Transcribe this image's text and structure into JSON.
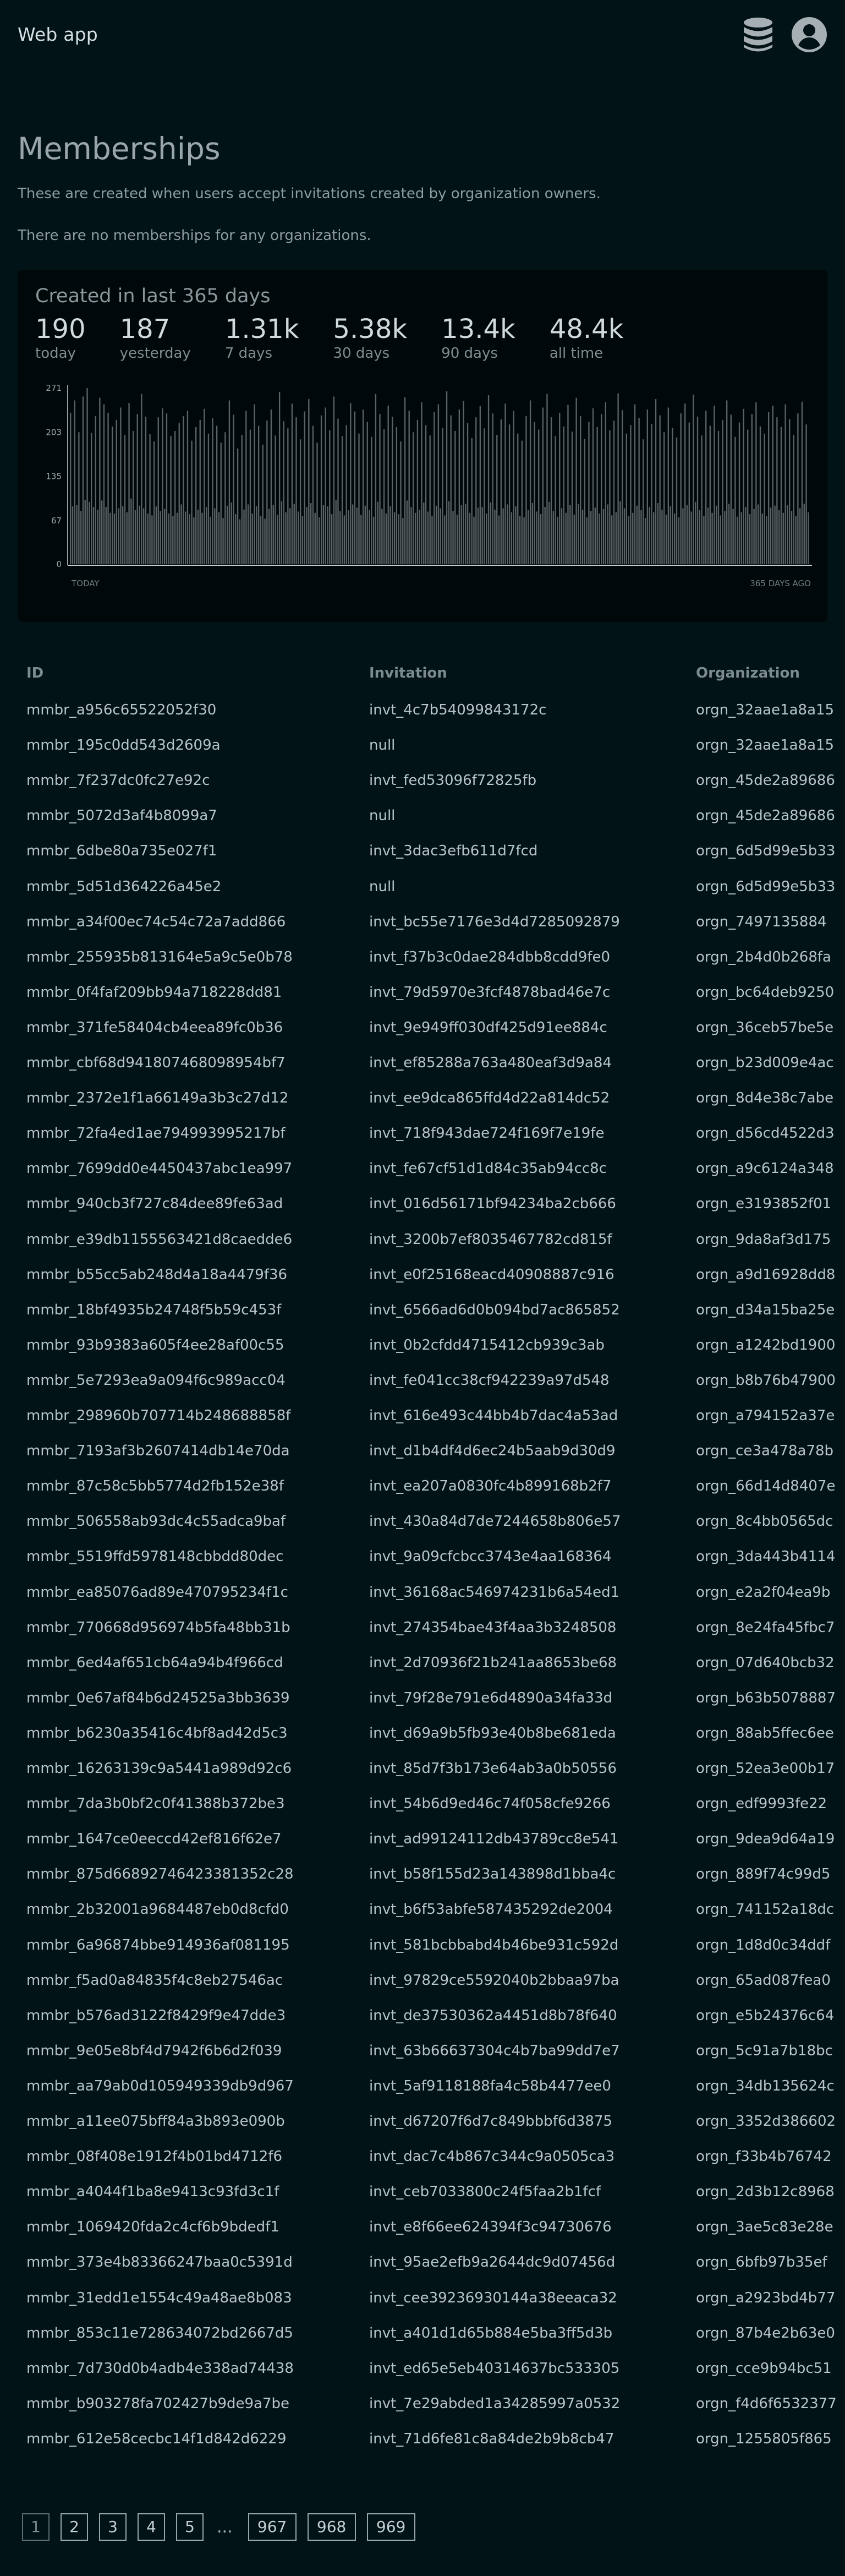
{
  "header": {
    "app_title": "Web app",
    "icons": [
      "database-icon",
      "user-account-icon"
    ]
  },
  "page": {
    "title": "Memberships",
    "description": "These are created when users accept invitations created by organization owners.",
    "empty_note": "There are no memberships for any organizations."
  },
  "stats_card": {
    "title": "Created in last 365 days",
    "stats": [
      {
        "value": "190",
        "label": "today"
      },
      {
        "value": "187",
        "label": "yesterday"
      },
      {
        "value": "1.31k",
        "label": "7 days"
      },
      {
        "value": "5.38k",
        "label": "30 days"
      },
      {
        "value": "13.4k",
        "label": "90 days"
      },
      {
        "value": "48.4k",
        "label": "all time"
      }
    ]
  },
  "chart_data": {
    "type": "bar",
    "y_ticks": [
      "271",
      "203",
      "135",
      "67",
      "0"
    ],
    "x_start_label": "TODAY",
    "x_end_label": "365 DAYS AGO",
    "ylim": [
      0,
      271
    ],
    "bar_count": 365,
    "bar_color": "#5b6265",
    "values": [
      233,
      89,
      252,
      91,
      203,
      82,
      258,
      99,
      271,
      96,
      202,
      88,
      228,
      84,
      256,
      98,
      246,
      88,
      233,
      79,
      212,
      78,
      222,
      86,
      241,
      89,
      199,
      80,
      248,
      101,
      205,
      83,
      231,
      90,
      262,
      86,
      227,
      78,
      200,
      75,
      189,
      89,
      226,
      82,
      240,
      85,
      232,
      78,
      197,
      74,
      205,
      79,
      217,
      92,
      228,
      81,
      236,
      77,
      190,
      72,
      211,
      84,
      222,
      79,
      239,
      88,
      201,
      73,
      225,
      86,
      213,
      80,
      187,
      71,
      203,
      90,
      252,
      95,
      230,
      77,
      178,
      69,
      199,
      84,
      236,
      92,
      207,
      78,
      246,
      89,
      213,
      74,
      184,
      70,
      221,
      85,
      238,
      91,
      198,
      76,
      265,
      97,
      220,
      80,
      209,
      86,
      247,
      93,
      226,
      81,
      192,
      74,
      235,
      88,
      254,
      94,
      213,
      79,
      187,
      72,
      229,
      91,
      241,
      89,
      206,
      77,
      258,
      99,
      224,
      82,
      197,
      75,
      214,
      83,
      248,
      92,
      235,
      87,
      201,
      76,
      238,
      90,
      219,
      84,
      196,
      73,
      262,
      96,
      231,
      85,
      208,
      78,
      244,
      89,
      227,
      80,
      211,
      77,
      189,
      71,
      257,
      98,
      236,
      88,
      203,
      79,
      222,
      84,
      249,
      95,
      214,
      81,
      198,
      74,
      234,
      90,
      246,
      86,
      210,
      75,
      266,
      97,
      229,
      82,
      205,
      76,
      238,
      91,
      251,
      93,
      217,
      79,
      194,
      73,
      226,
      87,
      243,
      88,
      209,
      78,
      260,
      95,
      232,
      84,
      199,
      75,
      223,
      86,
      247,
      92,
      215,
      80,
      236,
      89,
      201,
      74,
      190,
      72,
      228,
      83,
      252,
      94,
      219,
      81,
      207,
      77,
      241,
      88,
      262,
      96,
      226,
      82,
      197,
      73,
      233,
      86,
      212,
      79,
      245,
      91,
      204,
      76,
      256,
      93,
      228,
      84,
      193,
      72,
      219,
      82,
      240,
      87,
      211,
      78,
      231,
      85,
      249,
      92,
      206,
      75,
      221,
      80,
      263,
      97,
      237,
      86,
      201,
      74,
      214,
      79,
      246,
      90,
      225,
      83,
      192,
      71,
      238,
      88,
      216,
      80,
      254,
      94,
      229,
      84,
      203,
      76,
      241,
      89,
      210,
      78,
      195,
      72,
      232,
      86,
      247,
      91,
      218,
      81,
      261,
      96,
      227,
      83,
      198,
      74,
      236,
      87,
      213,
      79,
      244,
      90,
      205,
      75,
      222,
      82,
      252,
      93,
      230,
      85,
      196,
      73,
      218,
      80,
      239,
      88,
      207,
      77,
      231,
      85,
      249,
      92,
      212,
      78,
      201,
      74,
      234,
      87,
      244,
      90,
      226,
      83,
      211,
      79,
      246,
      91,
      223,
      82,
      199,
      74,
      232,
      86,
      250,
      93,
      215,
      80
    ]
  },
  "table": {
    "headers": [
      "ID",
      "Invitation",
      "Organization"
    ],
    "rows": [
      [
        "mmbr_a956c65522052f30",
        "invt_4c7b54099843172c",
        "orgn_32aae1a8a15"
      ],
      [
        "mmbr_195c0dd543d2609a",
        "null",
        "orgn_32aae1a8a15"
      ],
      [
        "mmbr_7f237dc0fc27e92c",
        "invt_fed53096f72825fb",
        "orgn_45de2a89686"
      ],
      [
        "mmbr_5072d3af4b8099a7",
        "null",
        "orgn_45de2a89686"
      ],
      [
        "mmbr_6dbe80a735e027f1",
        "invt_3dac3efb611d7fcd",
        "orgn_6d5d99e5b33"
      ],
      [
        "mmbr_5d51d364226a45e2",
        "null",
        "orgn_6d5d99e5b33"
      ],
      [
        "mmbr_a34f00ec74c54c72a7add866",
        "invt_bc55e7176e3d4d7285092879",
        "orgn_7497135884"
      ],
      [
        "mmbr_255935b813164e5a9c5e0b78",
        "invt_f37b3c0dae284dbb8cdd9fe0",
        "orgn_2b4d0b268fa"
      ],
      [
        "mmbr_0f4faf209bb94a718228dd81",
        "invt_79d5970e3fcf4878bad46e7c",
        "orgn_bc64deb9250"
      ],
      [
        "mmbr_371fe58404cb4eea89fc0b36",
        "invt_9e949ff030df425d91ee884c",
        "orgn_36ceb57be5e"
      ],
      [
        "mmbr_cbf68d941807468098954bf7",
        "invt_ef85288a763a480eaf3d9a84",
        "orgn_b23d009e4ac"
      ],
      [
        "mmbr_2372e1f1a66149a3b3c27d12",
        "invt_ee9dca865ffd4d22a814dc52",
        "orgn_8d4e38c7abe"
      ],
      [
        "mmbr_72fa4ed1ae794993995217bf",
        "invt_718f943dae724f169f7e19fe",
        "orgn_d56cd4522d3"
      ],
      [
        "mmbr_7699dd0e4450437abc1ea997",
        "invt_fe67cf51d1d84c35ab94cc8c",
        "orgn_a9c6124a348"
      ],
      [
        "mmbr_940cb3f727c84dee89fe63ad",
        "invt_016d56171bf94234ba2cb666",
        "orgn_e3193852f01"
      ],
      [
        "mmbr_e39db1155563421d8caedde6",
        "invt_3200b7ef8035467782cd815f",
        "orgn_9da8af3d175"
      ],
      [
        "mmbr_b55cc5ab248d4a18a4479f36",
        "invt_e0f25168eacd40908887c916",
        "orgn_a9d16928dd8"
      ],
      [
        "mmbr_18bf4935b24748f5b59c453f",
        "invt_6566ad6d0b094bd7ac865852",
        "orgn_d34a15ba25e"
      ],
      [
        "mmbr_93b9383a605f4ee28af00c55",
        "invt_0b2cfdd4715412cb939c3ab",
        "orgn_a1242bd1900"
      ],
      [
        "mmbr_5e7293ea9a094f6c989acc04",
        "invt_fe041cc38cf942239a97d548",
        "orgn_b8b76b47900"
      ],
      [
        "mmbr_298960b707714b248688858f",
        "invt_616e493c44bb4b7dac4a53ad",
        "orgn_a794152a37e"
      ],
      [
        "mmbr_7193af3b2607414db14e70da",
        "invt_d1b4df4d6ec24b5aab9d30d9",
        "orgn_ce3a478a78b"
      ],
      [
        "mmbr_87c58c5bb5774d2fb152e38f",
        "invt_ea207a0830fc4b899168b2f7",
        "orgn_66d14d8407e"
      ],
      [
        "mmbr_506558ab93dc4c55adca9baf",
        "invt_430a84d7de7244658b806e57",
        "orgn_8c4bb0565dc"
      ],
      [
        "mmbr_5519ffd5978148cbbdd80dec",
        "invt_9a09cfcbcc3743e4aa168364",
        "orgn_3da443b4114"
      ],
      [
        "mmbr_ea85076ad89e470795234f1c",
        "invt_36168ac546974231b6a54ed1",
        "orgn_e2a2f04ea9b"
      ],
      [
        "mmbr_770668d956974b5fa48bb31b",
        "invt_274354bae43f4aa3b3248508",
        "orgn_8e24fa45fbc7"
      ],
      [
        "mmbr_6ed4af651cb64a94b4f966cd",
        "invt_2d70936f21b241aa8653be68",
        "orgn_07d640bcb32"
      ],
      [
        "mmbr_0e67af84b6d24525a3bb3639",
        "invt_79f28e791e6d4890a34fa33d",
        "orgn_b63b5078887"
      ],
      [
        "mmbr_b6230a35416c4bf8ad42d5c3",
        "invt_d69a9b5fb93e40b8be681eda",
        "orgn_88ab5ffec6ee"
      ],
      [
        "mmbr_16263139c9a5441a989d92c6",
        "invt_85d7f3b173e64ab3a0b50556",
        "orgn_52ea3e00b17"
      ],
      [
        "mmbr_7da3b0bf2c0f41388b372be3",
        "invt_54b6d9ed46c74f058cfe9266",
        "orgn_edf9993fe22"
      ],
      [
        "mmbr_1647ce0eeccd42ef816f62e7",
        "invt_ad99124112db43789cc8e541",
        "orgn_9dea9d64a19"
      ],
      [
        "mmbr_875d66892746423381352c28",
        "invt_b58f155d23a143898d1bba4c",
        "orgn_889f74c99d5"
      ],
      [
        "mmbr_2b32001a9684487eb0d8cfd0",
        "invt_b6f53abfe587435292de2004",
        "orgn_741152a18dc"
      ],
      [
        "mmbr_6a96874bbe914936af081195",
        "invt_581bcbbabd4b46be931c592d",
        "orgn_1d8d0c34ddf"
      ],
      [
        "mmbr_f5ad0a84835f4c8eb27546ac",
        "invt_97829ce5592040b2bbaa97ba",
        "orgn_65ad087fea0"
      ],
      [
        "mmbr_b576ad3122f8429f9e47dde3",
        "invt_de37530362a4451d8b78f640",
        "orgn_e5b24376c64"
      ],
      [
        "mmbr_9e05e8bf4d7942f6b6d2f039",
        "invt_63b66637304c4b7ba99dd7e7",
        "orgn_5c91a7b18bc"
      ],
      [
        "mmbr_aa79ab0d105949339db9d967",
        "invt_5af9118188fa4c58b4477ee0",
        "orgn_34db135624c"
      ],
      [
        "mmbr_a11ee075bff84a3b893e090b",
        "invt_d67207f6d7c849bbbf6d3875",
        "orgn_3352d386602"
      ],
      [
        "mmbr_08f408e1912f4b01bd4712f6",
        "invt_dac7c4b867c344c9a0505ca3",
        "orgn_f33b4b76742"
      ],
      [
        "mmbr_a4044f1ba8e9413c93fd3c1f",
        "invt_ceb7033800c24f5faa2b1fcf",
        "orgn_2d3b12c8968"
      ],
      [
        "mmbr_1069420fda2c4cf6b9bdedf1",
        "invt_e8f66ee624394f3c94730676",
        "orgn_3ae5c83e28e"
      ],
      [
        "mmbr_373e4b83366247baa0c5391d",
        "invt_95ae2efb9a2644dc9d07456d",
        "orgn_6bfb97b35ef"
      ],
      [
        "mmbr_31edd1e1554c49a48ae8b083",
        "invt_cee39236930144a38eeaca32",
        "orgn_a2923bd4b77"
      ],
      [
        "mmbr_853c11e728634072bd2667d5",
        "invt_a401d1d65b884e5ba3ff5d3b",
        "orgn_87b4e2b63e0"
      ],
      [
        "mmbr_7d730d0b4adb4e338ad74438",
        "invt_ed65e5eb40314637bc533305",
        "orgn_cce9b94bc51"
      ],
      [
        "mmbr_b903278fa702427b9de9a7be",
        "invt_7e29abded1a34285997a0532",
        "orgn_f4d6f6532377"
      ],
      [
        "mmbr_612e58cecbc14f1d842d6229",
        "invt_71d6fe81c8a84de2b9b8cb47",
        "orgn_1255805f865"
      ]
    ]
  },
  "pagination": {
    "pages": [
      "1",
      "2",
      "3",
      "4",
      "5"
    ],
    "ellipsis": "...",
    "last_pages": [
      "967",
      "968",
      "969"
    ],
    "current": "1"
  }
}
